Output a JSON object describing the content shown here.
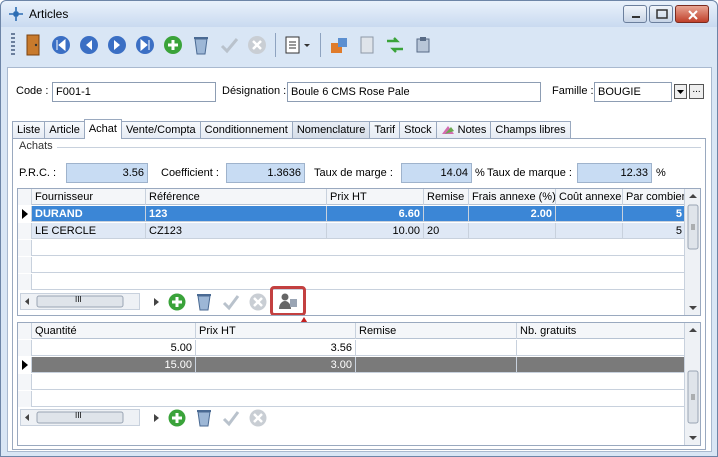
{
  "window": {
    "title": "Articles"
  },
  "header": {
    "code_label": "Code :",
    "code_value": "F001-1",
    "designation_label": "Désignation :",
    "designation_value": "Boule 6 CMS Rose Pale",
    "famille_label": "Famille :",
    "famille_value": "BOUGIE",
    "more_label": "..."
  },
  "tabs": [
    {
      "label": "Liste"
    },
    {
      "label": "Article"
    },
    {
      "label": "Achat"
    },
    {
      "label": "Vente/Compta"
    },
    {
      "label": "Conditionnement"
    },
    {
      "label": "Nomenclature"
    },
    {
      "label": "Tarif"
    },
    {
      "label": "Stock"
    },
    {
      "label": "Notes"
    },
    {
      "label": "Champs libres"
    }
  ],
  "achats": {
    "group_label": "Achats",
    "prc_label": "P.R.C. :",
    "prc_value": "3.56",
    "coef_label": "Coefficient :",
    "coef_value": "1.3636",
    "marge_label": "Taux de marge :",
    "marge_value": "14.04",
    "pct1": "%",
    "marque_label": "Taux de marque :",
    "marque_value": "12.33",
    "pct2": "%"
  },
  "suppliers": {
    "columns": [
      "Fournisseur",
      "Référence",
      "Prix HT",
      "Remise",
      "Frais annexe (%)",
      "Coût annexe",
      "Par combien"
    ],
    "rows": [
      {
        "fournisseur": "DURAND",
        "reference": "123",
        "prix": "6.60",
        "remise": "",
        "frais": "2.00",
        "cout": "",
        "par": "5"
      },
      {
        "fournisseur": "LE CERCLE",
        "reference": "CZ123",
        "prix": "10.00",
        "remise": "20",
        "frais": "",
        "cout": "",
        "par": "5"
      }
    ],
    "hscroll_label": "III"
  },
  "quantities": {
    "columns": [
      "Quantité",
      "Prix HT",
      "Remise",
      "Nb. gratuits"
    ],
    "rows": [
      {
        "qte": "5.00",
        "prix": "3.56",
        "remise": "",
        "gratuits": ""
      },
      {
        "qte": "15.00",
        "prix": "3.00",
        "remise": "",
        "gratuits": ""
      }
    ],
    "hscroll_label": "III"
  },
  "colors": {
    "accent": "#3b86d6",
    "highlight": "#c34040",
    "selection_dark": "#7a7a7a"
  }
}
